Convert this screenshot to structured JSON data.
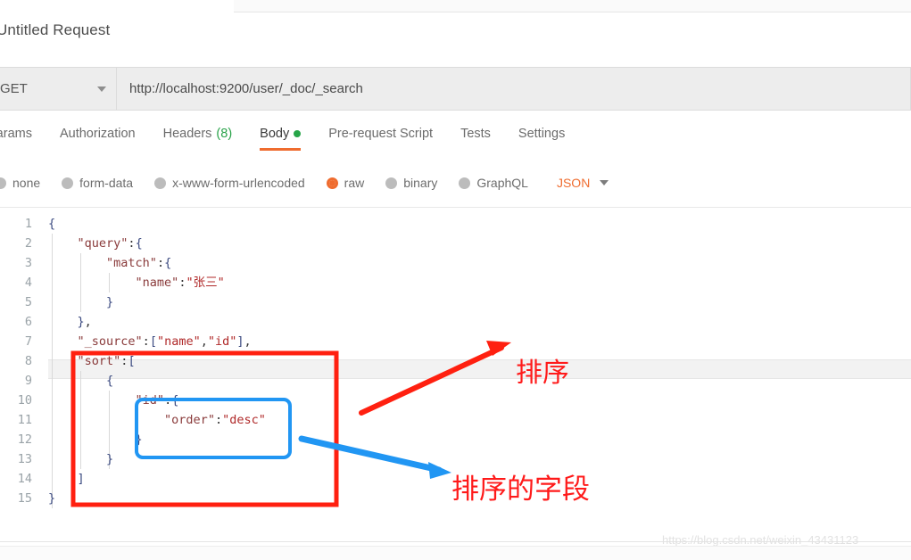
{
  "window": {
    "request_title": "Untitled Request"
  },
  "urlbar": {
    "method": "GET",
    "url": "http://localhost:9200/user/_doc/_search"
  },
  "tabs": [
    {
      "label": "Params",
      "badge": "",
      "active": false
    },
    {
      "label": "Authorization",
      "badge": "",
      "active": false
    },
    {
      "label": "Headers",
      "badge": "(8)",
      "active": false
    },
    {
      "label": "Body",
      "badge": "",
      "active": true
    },
    {
      "label": "Pre-request Script",
      "badge": "",
      "active": false
    },
    {
      "label": "Tests",
      "badge": "",
      "active": false
    },
    {
      "label": "Settings",
      "badge": "",
      "active": false
    }
  ],
  "body_types": [
    {
      "label": "none",
      "selected": false
    },
    {
      "label": "form-data",
      "selected": false
    },
    {
      "label": "x-www-form-urlencoded",
      "selected": false
    },
    {
      "label": "raw",
      "selected": true
    },
    {
      "label": "binary",
      "selected": false
    },
    {
      "label": "GraphQL",
      "selected": false
    }
  ],
  "format": {
    "selected": "JSON"
  },
  "editor": {
    "active_line": 11,
    "lines": [
      {
        "no": "1",
        "text": "{"
      },
      {
        "no": "2",
        "text": "    \"query\":{"
      },
      {
        "no": "3",
        "text": "        \"match\":{"
      },
      {
        "no": "4",
        "text": "            \"name\":\"张三\""
      },
      {
        "no": "5",
        "text": "        }"
      },
      {
        "no": "6",
        "text": "    },"
      },
      {
        "no": "7",
        "text": "    \"_source\":[\"name\",\"id\"],"
      },
      {
        "no": "8",
        "text": "    \"sort\":["
      },
      {
        "no": "9",
        "text": "        {"
      },
      {
        "no": "10",
        "text": "            \"id\":{"
      },
      {
        "no": "11",
        "text": "                \"order\":\"desc\""
      },
      {
        "no": "12",
        "text": "            }"
      },
      {
        "no": "13",
        "text": "        }"
      },
      {
        "no": "14",
        "text": "    ]"
      },
      {
        "no": "15",
        "text": "}"
      }
    ]
  },
  "annotations": {
    "sort_label": "排序",
    "sort_field_label": "排序的字段",
    "red_color": "#ff1a1a",
    "blue_color": "#2196f3"
  },
  "watermark": {
    "text": "https://blog.csdn.net/weixin_43431123"
  }
}
